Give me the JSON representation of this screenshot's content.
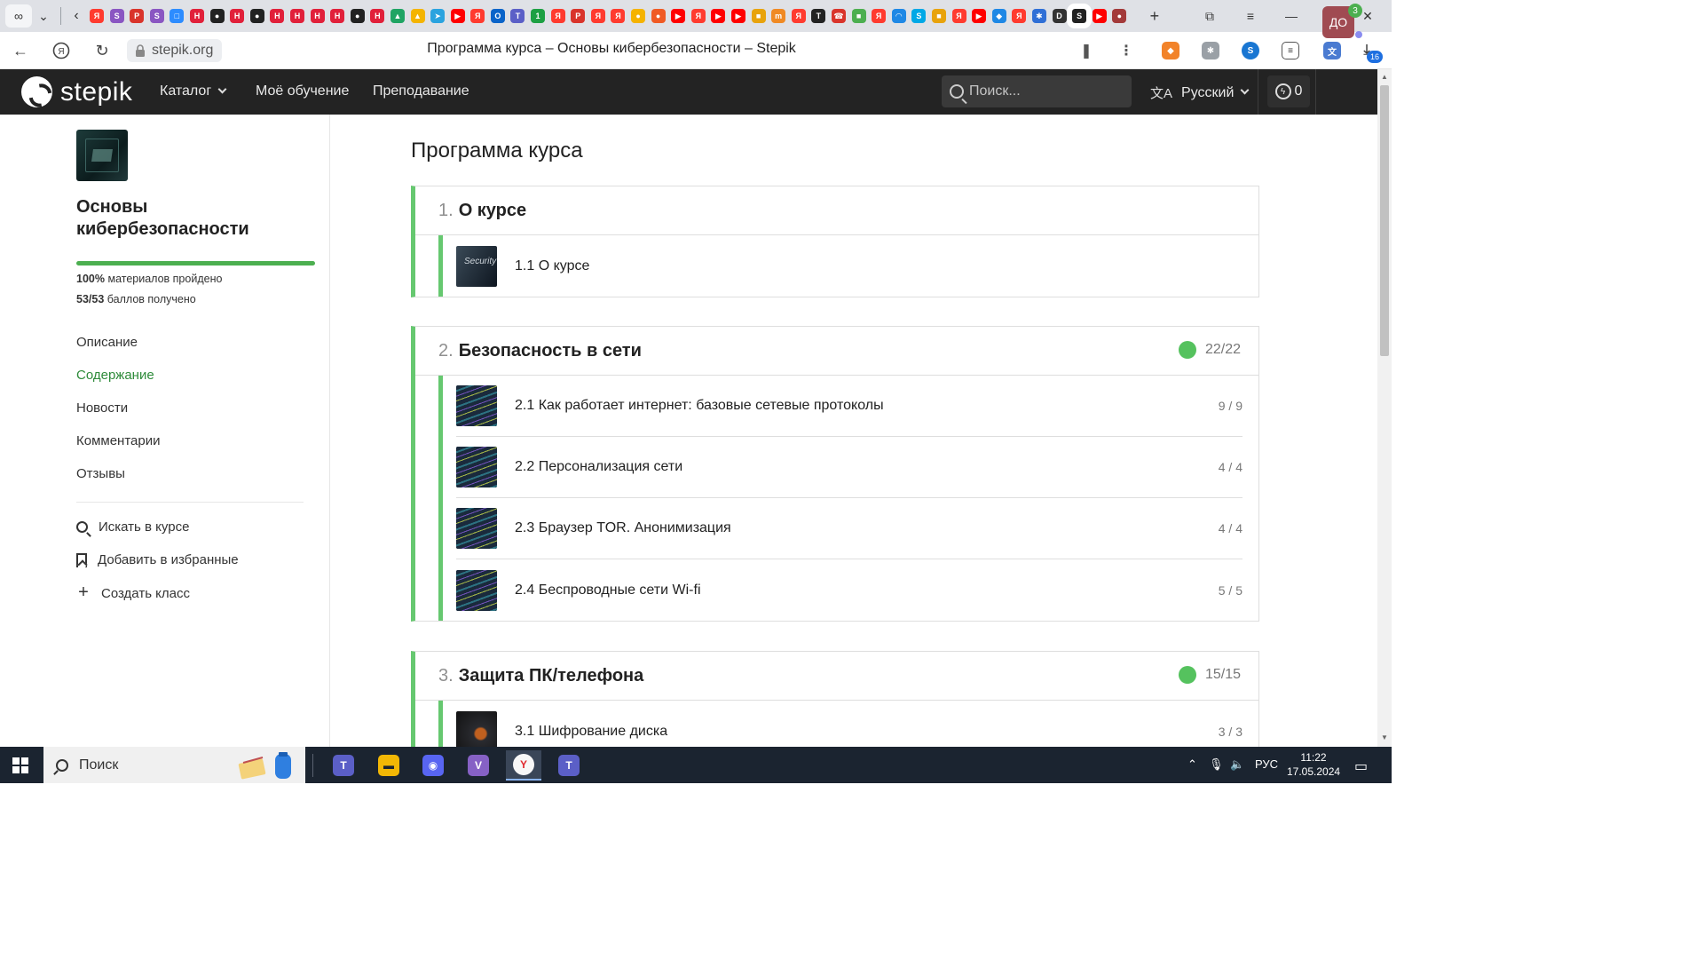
{
  "browser": {
    "url": "stepik.org",
    "window_title": "Программа курса – Основы кибербезопасности – Stepik",
    "tab_icons": [
      {
        "name": "yandex-icon",
        "color": "#ff3b2f",
        "glyph": "Я"
      },
      {
        "name": "stepik-icon",
        "color": "#8a56c2",
        "glyph": "S"
      },
      {
        "name": "pdf-icon",
        "color": "#d9342b",
        "glyph": "P"
      },
      {
        "name": "stepik-icon",
        "color": "#8a56c2",
        "glyph": "S"
      },
      {
        "name": "zoom-icon",
        "color": "#2d8cff",
        "glyph": "□"
      },
      {
        "name": "hh-icon",
        "color": "#e1203a",
        "glyph": "H"
      },
      {
        "name": "github-icon",
        "color": "#222222",
        "glyph": "●"
      },
      {
        "name": "hh-icon",
        "color": "#e1203a",
        "glyph": "H"
      },
      {
        "name": "github-icon",
        "color": "#222222",
        "glyph": "●"
      },
      {
        "name": "hh-icon",
        "color": "#e1203a",
        "glyph": "H"
      },
      {
        "name": "hh-icon",
        "color": "#e1203a",
        "glyph": "H"
      },
      {
        "name": "hh-icon",
        "color": "#e1203a",
        "glyph": "H"
      },
      {
        "name": "hh-icon",
        "color": "#e1203a",
        "glyph": "H"
      },
      {
        "name": "github-icon",
        "color": "#222222",
        "glyph": "●"
      },
      {
        "name": "hh-icon",
        "color": "#e1203a",
        "glyph": "H"
      },
      {
        "name": "drive-icon",
        "color": "#1fa463",
        "glyph": "▲"
      },
      {
        "name": "drive-icon",
        "color": "#f4b400",
        "glyph": "▲"
      },
      {
        "name": "telegram-icon",
        "color": "#2aa3df",
        "glyph": "➤"
      },
      {
        "name": "youtube-icon",
        "color": "#ff0000",
        "glyph": "▶"
      },
      {
        "name": "yandex-icon",
        "color": "#ff3b2f",
        "glyph": "Я"
      },
      {
        "name": "outlook-icon",
        "color": "#0a64c9",
        "glyph": "O"
      },
      {
        "name": "teams-icon",
        "color": "#5b5fc7",
        "glyph": "T"
      },
      {
        "name": "one-icon",
        "color": "#1da043",
        "glyph": "1"
      },
      {
        "name": "yandex-icon",
        "color": "#ff3b2f",
        "glyph": "Я"
      },
      {
        "name": "pdf-icon",
        "color": "#d9342b",
        "glyph": "P"
      },
      {
        "name": "yandex-icon",
        "color": "#ff3b2f",
        "glyph": "Я"
      },
      {
        "name": "yandex-icon",
        "color": "#ff3b2f",
        "glyph": "Я"
      },
      {
        "name": "bulb-icon",
        "color": "#f5b300",
        "glyph": "●"
      },
      {
        "name": "brave-icon",
        "color": "#f05a24",
        "glyph": "●"
      },
      {
        "name": "youtube-icon",
        "color": "#ff0000",
        "glyph": "▶"
      },
      {
        "name": "yandex-icon",
        "color": "#ff3b2f",
        "glyph": "Я"
      },
      {
        "name": "youtube-icon",
        "color": "#ff0000",
        "glyph": "▶"
      },
      {
        "name": "youtube-icon",
        "color": "#ff0000",
        "glyph": "▶"
      },
      {
        "name": "grid-icon",
        "color": "#e8a30c",
        "glyph": "■"
      },
      {
        "name": "habr-icon",
        "color": "#f08a24",
        "glyph": "m"
      },
      {
        "name": "yandex-icon",
        "color": "#ff3b2f",
        "glyph": "Я"
      },
      {
        "name": "t-icon",
        "color": "#222222",
        "glyph": "T"
      },
      {
        "name": "phone-icon",
        "color": "#d9342b",
        "glyph": "☎"
      },
      {
        "name": "grid-icon",
        "color": "#4caf50",
        "glyph": "■"
      },
      {
        "name": "yandex-icon",
        "color": "#ff3b2f",
        "glyph": "Я"
      },
      {
        "name": "wifi-icon",
        "color": "#1e88e5",
        "glyph": "◠"
      },
      {
        "name": "skype-icon",
        "color": "#00a8e6",
        "glyph": "S"
      },
      {
        "name": "grid-icon",
        "color": "#e8a30c",
        "glyph": "■"
      },
      {
        "name": "yandex-icon",
        "color": "#ff3b2f",
        "glyph": "Я"
      },
      {
        "name": "youtube-icon",
        "color": "#ff0000",
        "glyph": "▶"
      },
      {
        "name": "dispatch-icon",
        "color": "#1e88e5",
        "glyph": "◆"
      },
      {
        "name": "yandex-icon",
        "color": "#ff3b2f",
        "glyph": "Я"
      },
      {
        "name": "react-icon",
        "color": "#2f6fd6",
        "glyph": "✱"
      },
      {
        "name": "d-icon",
        "color": "#333333",
        "glyph": "D"
      },
      {
        "name": "stepik-icon",
        "color": "#222222",
        "glyph": "S"
      },
      {
        "name": "youtube-icon",
        "color": "#ff0000",
        "glyph": "▶"
      },
      {
        "name": "chatgpt-icon",
        "color": "#a33a3a",
        "glyph": "●"
      }
    ],
    "extension_badge": "16"
  },
  "header": {
    "logo_text": "stepik",
    "nav": [
      "Каталог",
      "Моё обучение",
      "Преподавание"
    ],
    "search_placeholder": "Поиск...",
    "language": "Русский",
    "energy_count": "0",
    "avatar_initials": "ДО",
    "avatar_badge": "3"
  },
  "sidebar": {
    "course_title": "Основы кибербезопасности",
    "progress_fraction": 1.0,
    "materials_pct": "100%",
    "materials_label": "материалов пройдено",
    "points": "53/53",
    "points_label": "баллов получено",
    "nav": [
      {
        "label": "Описание",
        "active": false
      },
      {
        "label": "Содержание",
        "active": true
      },
      {
        "label": "Новости",
        "active": false
      },
      {
        "label": "Комментарии",
        "active": false
      },
      {
        "label": "Отзывы",
        "active": false
      }
    ],
    "actions": {
      "search": "Искать в курсе",
      "favorite": "Добавить в избранные",
      "create_class": "Создать класс"
    }
  },
  "main": {
    "title": "Программа курса",
    "modules": [
      {
        "number": "1.",
        "title": "О курсе",
        "score": "",
        "lessons": [
          {
            "title": "1.1 О курсе",
            "score": "",
            "thumb": "security",
            "thumb_text": "Security"
          }
        ]
      },
      {
        "number": "2.",
        "title": "Безопасность в сети",
        "score": "22/22",
        "lessons": [
          {
            "title": "2.1 Как работает интернет: базовые сетевые протоколы",
            "score": "9 / 9",
            "thumb": "code"
          },
          {
            "title": "2.2 Персонализация сети",
            "score": "4 / 4",
            "thumb": "code"
          },
          {
            "title": "2.3 Браузер TOR. Анонимизация",
            "score": "4 / 4",
            "thumb": "code"
          },
          {
            "title": "2.4 Беспроводные сети Wi-fi",
            "score": "5 / 5",
            "thumb": "code"
          }
        ]
      },
      {
        "number": "3.",
        "title": "Защита ПК/телефона",
        "score": "15/15",
        "lessons": [
          {
            "title": "3.1 Шифрование диска",
            "score": "3 / 3",
            "thumb": "disk"
          }
        ]
      }
    ]
  },
  "taskbar": {
    "search_placeholder": "Поиск",
    "apps": [
      {
        "name": "teams-app",
        "color": "#5b5fc7",
        "glyph": "T"
      },
      {
        "name": "explorer-app",
        "color": "#f2b705",
        "glyph": "▬"
      },
      {
        "name": "discord-app",
        "color": "#5865f2",
        "glyph": "◉"
      },
      {
        "name": "visual-studio-app",
        "color": "#8661c5",
        "glyph": "V"
      },
      {
        "name": "yandex-browser-app",
        "color": "#f7f7f7",
        "glyph": "Y"
      },
      {
        "name": "teams-notify-app",
        "color": "#5b5fc7",
        "glyph": "T"
      }
    ],
    "lang": "РУС",
    "time": "11:22",
    "date": "17.05.2024"
  },
  "colors": {
    "accent_green": "#66c870",
    "active_link": "#2e8b3a",
    "header_bg": "#232323"
  }
}
